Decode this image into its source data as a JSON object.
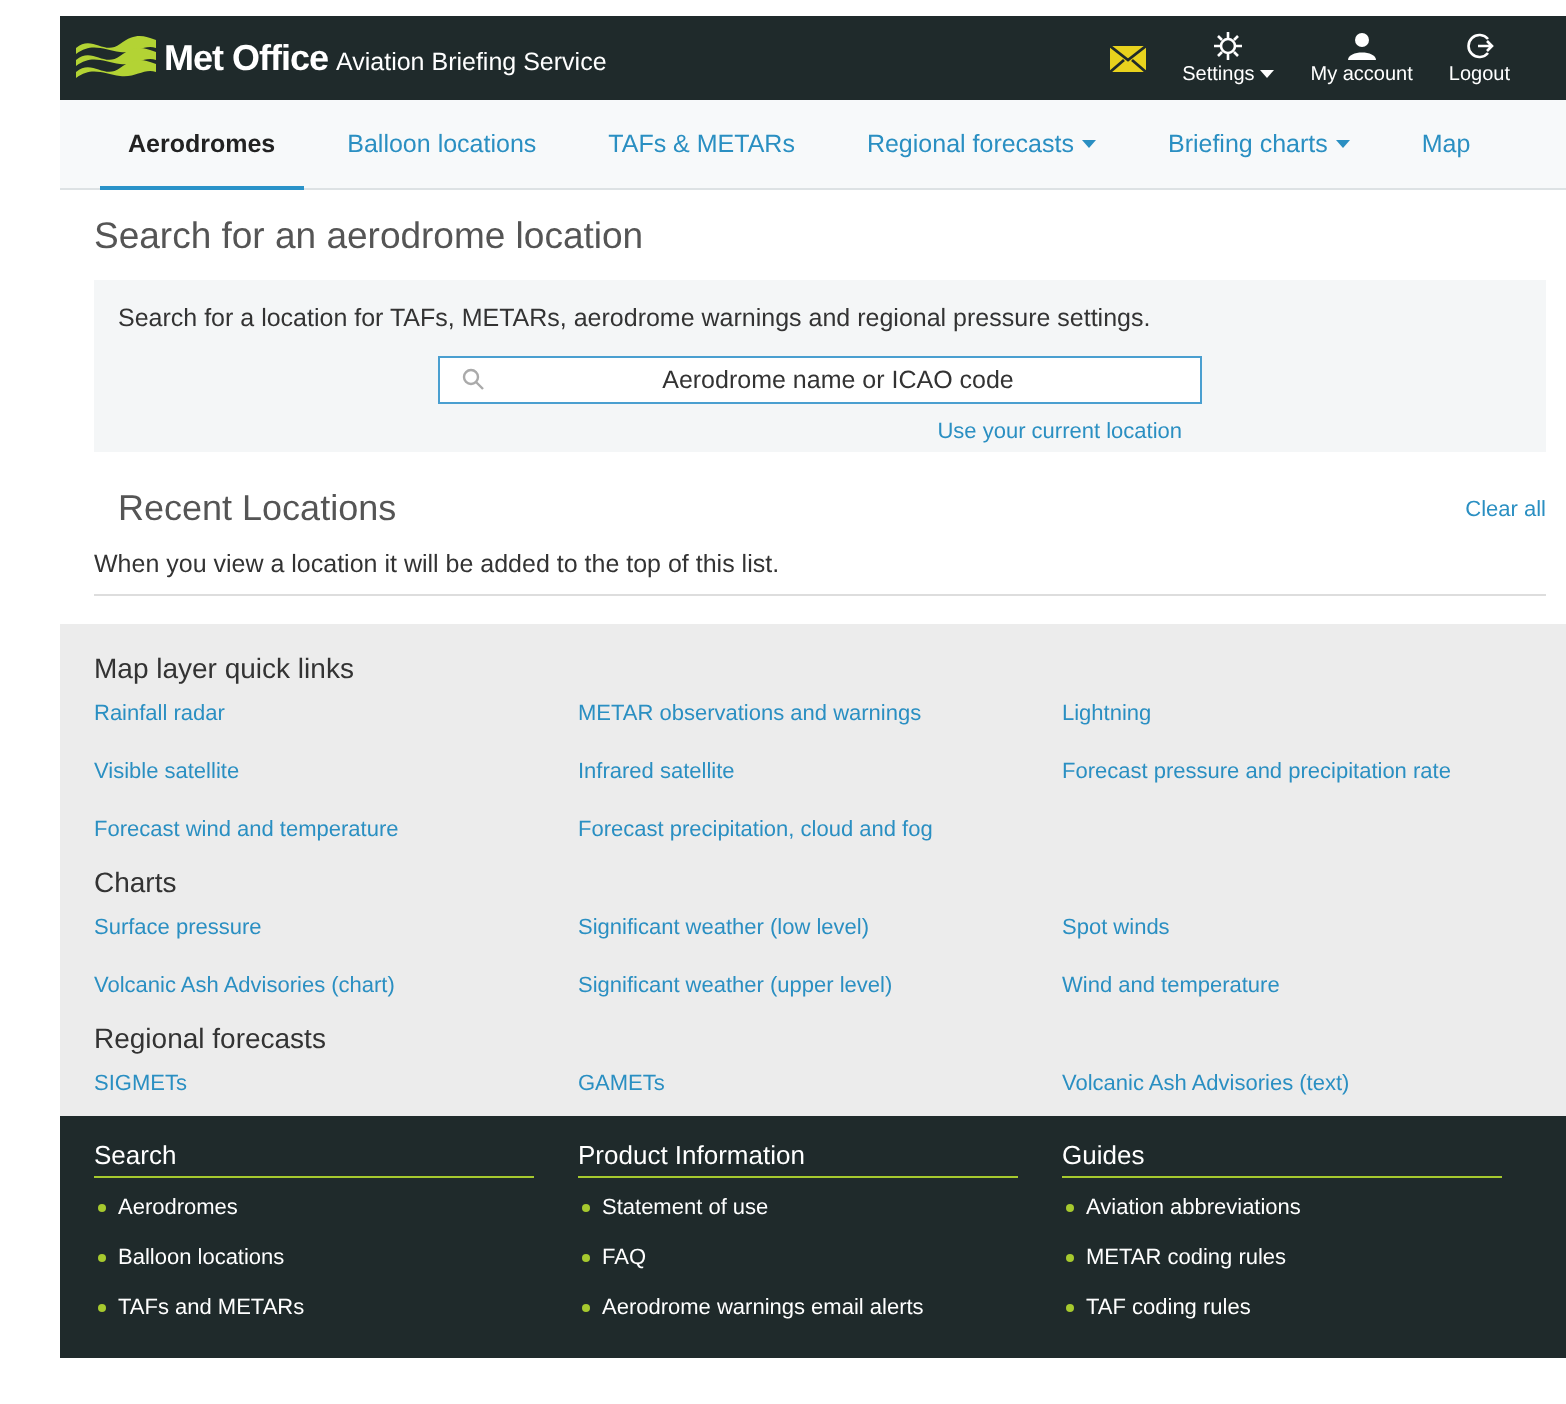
{
  "header": {
    "logo": "Met Office",
    "subtitle": "Aviation Briefing Service",
    "actions": [
      {
        "kind": "mail"
      },
      {
        "kind": "settings",
        "label": "Settings",
        "dropdown": true
      },
      {
        "kind": "account",
        "label": "My account",
        "dropdown": false
      },
      {
        "kind": "logout",
        "label": "Logout",
        "dropdown": false
      }
    ]
  },
  "tabs": [
    {
      "label": "Aerodromes",
      "selected": true,
      "dropdown": false
    },
    {
      "label": "Balloon locations",
      "selected": false,
      "dropdown": false
    },
    {
      "label": "TAFs & METARs",
      "selected": false,
      "dropdown": false
    },
    {
      "label": "Regional forecasts",
      "selected": false,
      "dropdown": true
    },
    {
      "label": "Briefing charts",
      "selected": false,
      "dropdown": true
    },
    {
      "label": "Map",
      "selected": false,
      "dropdown": false
    }
  ],
  "search": {
    "title": "Search for an aerodrome location",
    "description": "Search for a location for TAFs, METARs, aerodrome warnings and regional pressure settings.",
    "placeholder": "Aerodrome name or ICAO code",
    "location_link": "Use your current location"
  },
  "recent": {
    "title": "Recent Locations",
    "clear": "Clear all",
    "note": "When you view a location it will be added to the top of this list."
  },
  "quick_links": [
    {
      "title": "Map layer quick links",
      "links": [
        "Rainfall radar",
        "METAR observations and warnings",
        "Lightning",
        "Visible satellite",
        "Infrared satellite",
        "Forecast pressure and precipitation rate",
        "Forecast wind and temperature",
        "Forecast precipitation, cloud and fog"
      ]
    },
    {
      "title": "Charts",
      "links": [
        "Surface pressure",
        "Significant weather (low level)",
        "Spot winds",
        "Volcanic Ash Advisories (chart)",
        "Significant weather (upper level)",
        "Wind and temperature"
      ]
    },
    {
      "title": "Regional forecasts",
      "links": [
        "SIGMETs",
        "GAMETs",
        "Volcanic Ash Advisories (text)"
      ]
    }
  ],
  "footer": [
    {
      "title": "Search",
      "items": [
        "Aerodromes",
        "Balloon locations",
        "TAFs and METARs"
      ]
    },
    {
      "title": "Product Information",
      "items": [
        "Statement of use",
        "FAQ",
        "Aerodrome warnings email alerts"
      ]
    },
    {
      "title": "Guides",
      "items": [
        "Aviation abbreviations",
        "METAR coding rules",
        "TAF coding rules"
      ]
    }
  ]
}
